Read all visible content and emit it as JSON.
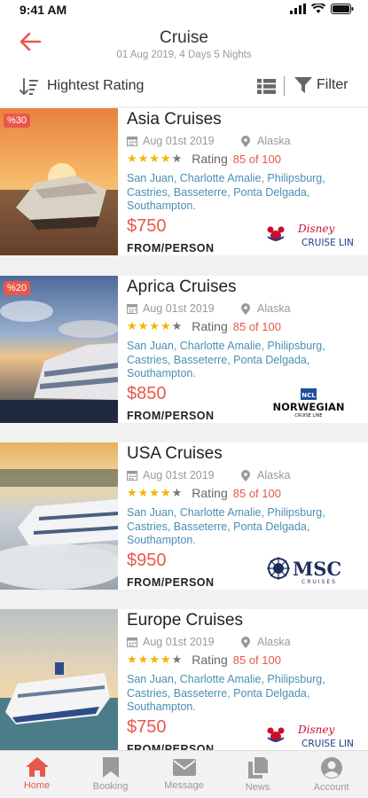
{
  "status": {
    "time": "9:41 AM"
  },
  "header": {
    "title": "Cruise",
    "subtitle": "01 Aug 2019, 4 Days 5 Nights"
  },
  "toolbar": {
    "sort_label": "Hightest Rating",
    "filter_label": "Filter"
  },
  "colors": {
    "accent": "#e8584a",
    "link": "#4a8fb5",
    "star": "#f5b300"
  },
  "cruises": [
    {
      "title": "Asia Cruises",
      "discount": "%30",
      "date": "Aug 01st 2019",
      "location": "Alaska",
      "stars": 4,
      "rating_label": "Rating",
      "rating_value": "85 of 100",
      "ports": "San Juan, Charlotte Amalie, Philipsburg, Castries, Basseterre, Ponta Delgada, Southampton.",
      "price": "$750",
      "per_person": "FROM/PERSON",
      "logo_icon": "disney-cruise-line-logo",
      "logo_text": [
        "Disney",
        "CRUISE LINE"
      ]
    },
    {
      "title": "Aprica Cruises",
      "discount": "%20",
      "date": "Aug 01st 2019",
      "location": "Alaska",
      "stars": 4,
      "rating_label": "Rating",
      "rating_value": "85 of 100",
      "ports": "San Juan, Charlotte Amalie, Philipsburg, Castries, Basseterre, Ponta Delgada, Southampton.",
      "price": "$850",
      "per_person": "FROM/PERSON",
      "logo_icon": "norwegian-cruise-line-logo",
      "logo_text": [
        "NCL",
        "NORWEGIAN",
        "CRUISE LINE"
      ]
    },
    {
      "title": "USA Cruises",
      "discount": "",
      "date": "Aug 01st 2019",
      "location": "Alaska",
      "stars": 4,
      "rating_label": "Rating",
      "rating_value": "85 of 100",
      "ports": "San Juan, Charlotte Amalie, Philipsburg, Castries, Basseterre, Ponta Delgada, Southampton.",
      "price": "$950",
      "per_person": "FROM/PERSON",
      "logo_icon": "msc-cruises-logo",
      "logo_text": [
        "MSC",
        "CRUISES"
      ]
    },
    {
      "title": "Europe Cruises",
      "discount": "",
      "date": "Aug 01st 2019",
      "location": "Alaska",
      "stars": 4,
      "rating_label": "Rating",
      "rating_value": "85 of 100",
      "ports": "San Juan, Charlotte Amalie, Philipsburg, Castries, Basseterre, Ponta Delgada, Southampton.",
      "price": "$750",
      "per_person": "FROM/PERSON",
      "logo_icon": "disney-cruise-line-logo",
      "logo_text": [
        "Disney",
        "CRUISE LINE"
      ]
    }
  ],
  "tabs": [
    {
      "label": "Home",
      "icon": "home-icon",
      "active": true
    },
    {
      "label": "Booking",
      "icon": "bookmark-icon",
      "active": false
    },
    {
      "label": "Message",
      "icon": "envelope-icon",
      "active": false
    },
    {
      "label": "News",
      "icon": "documents-icon",
      "active": false
    },
    {
      "label": "Account",
      "icon": "user-icon",
      "active": false
    }
  ]
}
